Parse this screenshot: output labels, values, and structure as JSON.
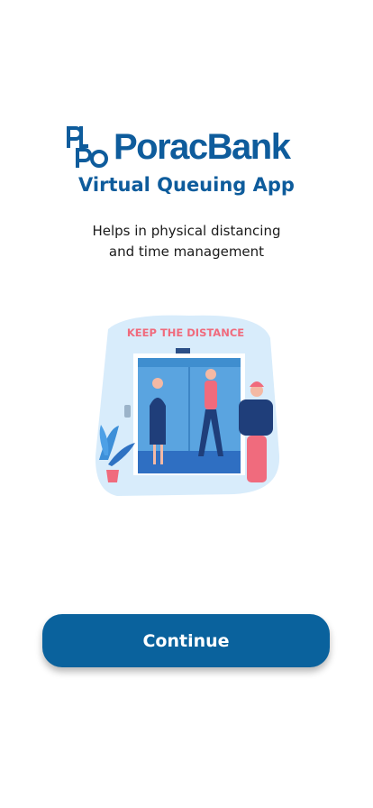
{
  "brand": {
    "name": "PoracBank",
    "subtitle": "Virtual Queuing App",
    "color": "#0e5c9c"
  },
  "tagline": {
    "line1": "Helps in physical distancing",
    "line2": "and time management"
  },
  "illustration": {
    "banner": "KEEP THE DISTANCE",
    "icon": "elevator-distancing-illustration"
  },
  "actions": {
    "continue_label": "Continue",
    "button_color": "#0a629d"
  }
}
